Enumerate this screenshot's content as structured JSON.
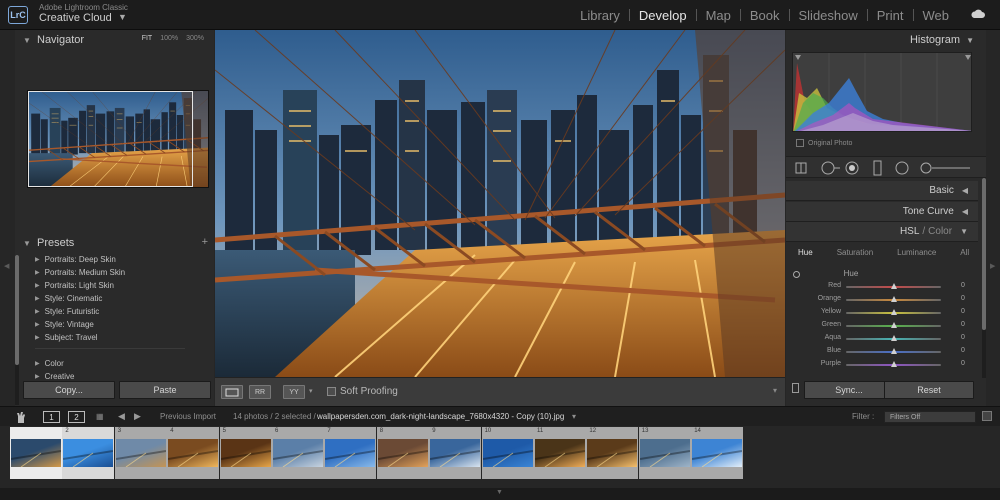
{
  "app": {
    "logo": "LrC",
    "brand_small": "Adobe Lightroom Classic",
    "brand_big": "Creative Cloud",
    "brand_caret": "▼",
    "modules": [
      "Library",
      "Develop",
      "Map",
      "Book",
      "Slideshow",
      "Print",
      "Web"
    ],
    "active_module": "Develop"
  },
  "left_panel": {
    "navigator": {
      "title": "Navigator",
      "zoom_options": [
        "FIT",
        "100%",
        "300%"
      ],
      "selected_zoom": "FIT"
    },
    "presets": {
      "title": "Presets",
      "plus": "+",
      "items": [
        "Portraits: Deep Skin",
        "Portraits: Medium Skin",
        "Portraits: Light Skin",
        "Style: Cinematic",
        "Style: Futuristic",
        "Style: Vintage",
        "Subject: Travel"
      ],
      "items2": [
        "Color",
        "Creative"
      ]
    },
    "copy_label": "Copy...",
    "paste_label": "Paste"
  },
  "toolbar": {
    "soft_proofing": "Soft Proofing",
    "ba_label": "YY",
    "rr_label": "RR"
  },
  "right_panel": {
    "histogram_title": "Histogram",
    "original_photo": "Original Photo",
    "sections": {
      "basic": "Basic",
      "tone_curve": "Tone Curve",
      "hsl": "HSL",
      "color": "Color"
    },
    "hsl_tabs": [
      "Hue",
      "Saturation",
      "Luminance",
      "All"
    ],
    "selected_tab": "Hue",
    "hue_title": "Hue",
    "sliders": [
      {
        "label": "Red",
        "value": "0",
        "color": "#c44a4a"
      },
      {
        "label": "Orange",
        "value": "0",
        "color": "#c7883d"
      },
      {
        "label": "Yellow",
        "value": "0",
        "color": "#c9c13f"
      },
      {
        "label": "Green",
        "value": "0",
        "color": "#58b14c"
      },
      {
        "label": "Aqua",
        "value": "0",
        "color": "#46b4b3"
      },
      {
        "label": "Blue",
        "value": "0",
        "color": "#4a6fc7"
      },
      {
        "label": "Purple",
        "value": "0",
        "color": "#8e55c3"
      }
    ],
    "sync_label": "Sync...",
    "reset_label": "Reset"
  },
  "filmstrip_header": {
    "view1": "1",
    "view2": "2",
    "previous_import": "Previous Import",
    "count": "14 photos / 2 selected /",
    "filename": "wallpapersden.com_dark-night-landscape_7680x4320 - Copy (10).jpg",
    "filename_caret": "▾",
    "filter_label": "Filter :",
    "filter_value": "Filters Off"
  },
  "filmstrip": {
    "numbers": [
      "",
      "2",
      "3",
      "4",
      "5",
      "6",
      "7",
      "8",
      "9",
      "10",
      "11",
      "12",
      "13",
      "14"
    ]
  }
}
